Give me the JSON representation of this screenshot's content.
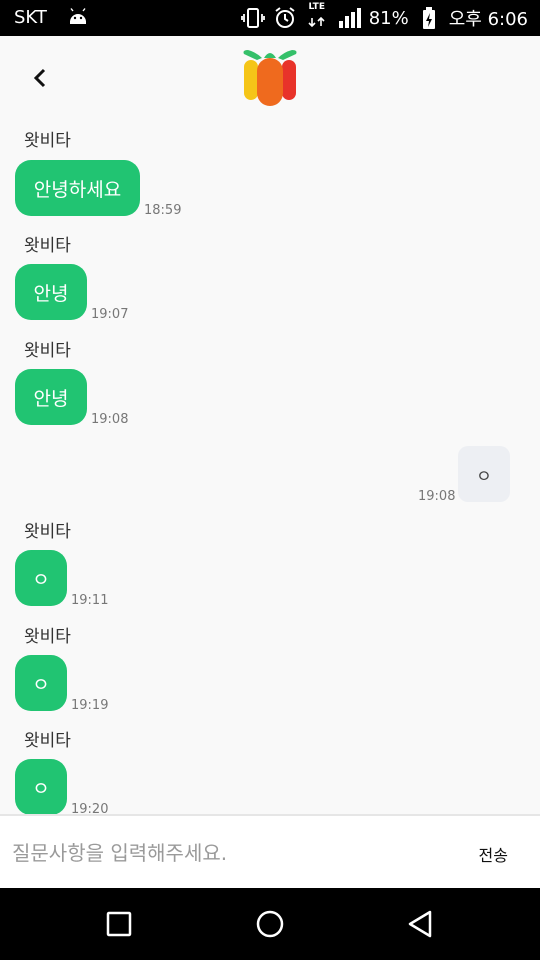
{
  "status_bar": {
    "carrier": "SKT",
    "network": "LTE",
    "battery": "81%",
    "time": "오후 6:06"
  },
  "chat": {
    "messages": [
      {
        "sender": "왓비타",
        "text": "안녕하세요",
        "time": "18:59"
      },
      {
        "sender": "왓비타",
        "text": "안녕",
        "time": "19:07"
      },
      {
        "sender": "왓비타",
        "text": "안녕",
        "time": "19:08"
      },
      {
        "sender": "",
        "text": "ㅇ",
        "time": "19:08"
      },
      {
        "sender": "왓비타",
        "text": "ㅇ",
        "time": "19:11"
      },
      {
        "sender": "왓비타",
        "text": "ㅇ",
        "time": "19:19"
      },
      {
        "sender": "왓비타",
        "text": "ㅇ",
        "time": "19:20"
      }
    ]
  },
  "input": {
    "placeholder": "질문사항을 입력해주세요.",
    "send_label": "전송"
  },
  "colors": {
    "incoming_bubble": "#21c472",
    "outgoing_bubble": "#edeff3"
  },
  "icons": {
    "back": "chevron-left-icon",
    "logo": "vegetable-logo-icon",
    "nav": [
      "square-recent-icon",
      "circle-home-icon",
      "triangle-back-icon"
    ]
  }
}
